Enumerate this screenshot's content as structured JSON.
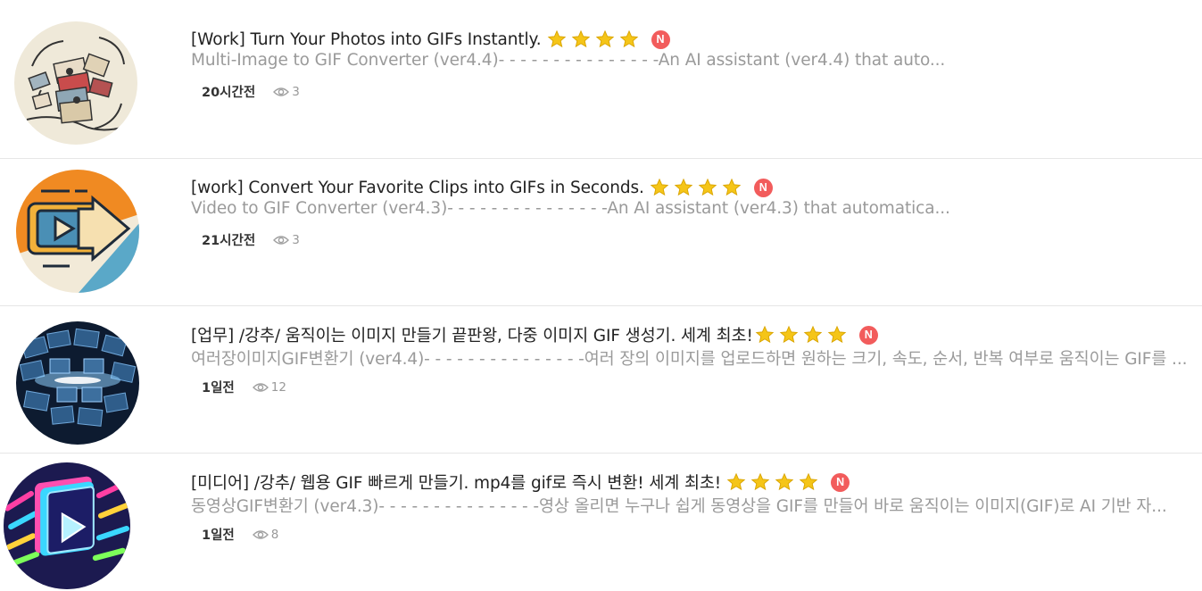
{
  "posts": [
    {
      "title": "[Work] Turn Your Photos into GIFs Instantly.",
      "description": "Multi-Image to GIF Converter (ver4.4)- - - - - - - - - - - - - - -An AI assistant (ver4.4) that auto...",
      "rating": 4,
      "badge": "N",
      "time": "20시간전",
      "views": "3",
      "thumbnail": "sketch-stacked-photos-icon"
    },
    {
      "title": "[work] Convert Your Favorite Clips into GIFs in Seconds.",
      "description": "Video to GIF Converter (ver4.3)- - - - - - - - - - - - - - -An AI assistant (ver4.3) that automatica...",
      "rating": 4,
      "badge": "N",
      "time": "21시간전",
      "views": "3",
      "thumbnail": "video-to-gif-arrow-icon"
    },
    {
      "title": "[업무] /강추/ 움직이는 이미지 만들기 끝판왕, 다중 이미지 GIF 생성기. 세계 최초!",
      "description": "여러장이미지GIF변환기 (ver4.4)- - - - - - - - - - - - - - -여러 장의 이미지를 업로드하면 원하는 크기, 속도, 순서, 반복 여부로 움직이는 GIF를 ...",
      "rating": 4,
      "badge": "N",
      "time": "1일전",
      "views": "12",
      "thumbnail": "digital-image-grid-icon"
    },
    {
      "title": "[미디어] /강추/ 웹용 GIF 빠르게 만들기. mp4를 gif로 즉시 변환! 세계 최초!",
      "description": "동영상GIF변환기 (ver4.3)- - - - - - - - - - - - - - -영상 올리면 누구나 쉽게 동영상을 GIF를 만들어 바로 움직이는 이미지(GIF)로 AI 기반 자...",
      "rating": 4,
      "badge": "N",
      "time": "1일전",
      "views": "8",
      "thumbnail": "neon-play-button-icon"
    }
  ],
  "colors": {
    "title": "#222222",
    "description": "#9a9a9a",
    "badge": "#f25c5c",
    "star": "#f5c518"
  }
}
